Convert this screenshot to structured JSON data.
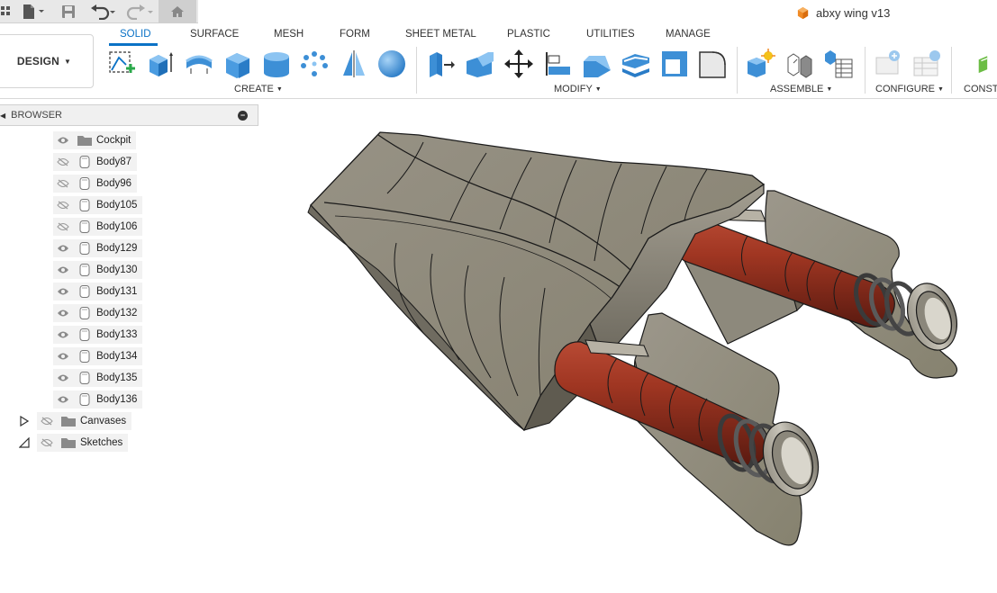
{
  "document": {
    "title": "abxy wing v13"
  },
  "quick_access": {
    "icons": [
      "grid-icon",
      "file-icon",
      "save-icon",
      "undo-icon",
      "redo-icon",
      "home-icon"
    ]
  },
  "workspace": {
    "label": "DESIGN"
  },
  "tabs": [
    {
      "label": "SOLID",
      "active": true
    },
    {
      "label": "SURFACE",
      "active": false
    },
    {
      "label": "MESH",
      "active": false
    },
    {
      "label": "FORM",
      "active": false
    },
    {
      "label": "SHEET METAL",
      "active": false
    },
    {
      "label": "PLASTIC",
      "active": false
    },
    {
      "label": "UTILITIES",
      "active": false
    },
    {
      "label": "MANAGE",
      "active": false
    }
  ],
  "groups": {
    "create": "CREATE",
    "modify": "MODIFY",
    "assemble": "ASSEMBLE",
    "configure": "CONFIGURE",
    "construct": "CONSTR"
  },
  "browser": {
    "title": "BROWSER",
    "items": [
      {
        "label": "Cockpit",
        "type": "folder",
        "visible": true
      },
      {
        "label": "Body87",
        "type": "body",
        "visible": false
      },
      {
        "label": "Body96",
        "type": "body",
        "visible": false
      },
      {
        "label": "Body105",
        "type": "body",
        "visible": false
      },
      {
        "label": "Body106",
        "type": "body",
        "visible": false
      },
      {
        "label": "Body129",
        "type": "body",
        "visible": true
      },
      {
        "label": "Body130",
        "type": "body",
        "visible": true
      },
      {
        "label": "Body131",
        "type": "body",
        "visible": true
      },
      {
        "label": "Body132",
        "type": "body",
        "visible": true
      },
      {
        "label": "Body133",
        "type": "body",
        "visible": true
      },
      {
        "label": "Body134",
        "type": "body",
        "visible": true
      },
      {
        "label": "Body135",
        "type": "body",
        "visible": true
      },
      {
        "label": "Body136",
        "type": "body",
        "visible": true
      }
    ],
    "folders": [
      {
        "label": "Canvases",
        "visible": false
      },
      {
        "label": "Sketches",
        "visible": false
      }
    ]
  },
  "colors": {
    "accent": "#0b72c6",
    "model_body": "#8a857a",
    "model_red": "#9b2f1e"
  }
}
